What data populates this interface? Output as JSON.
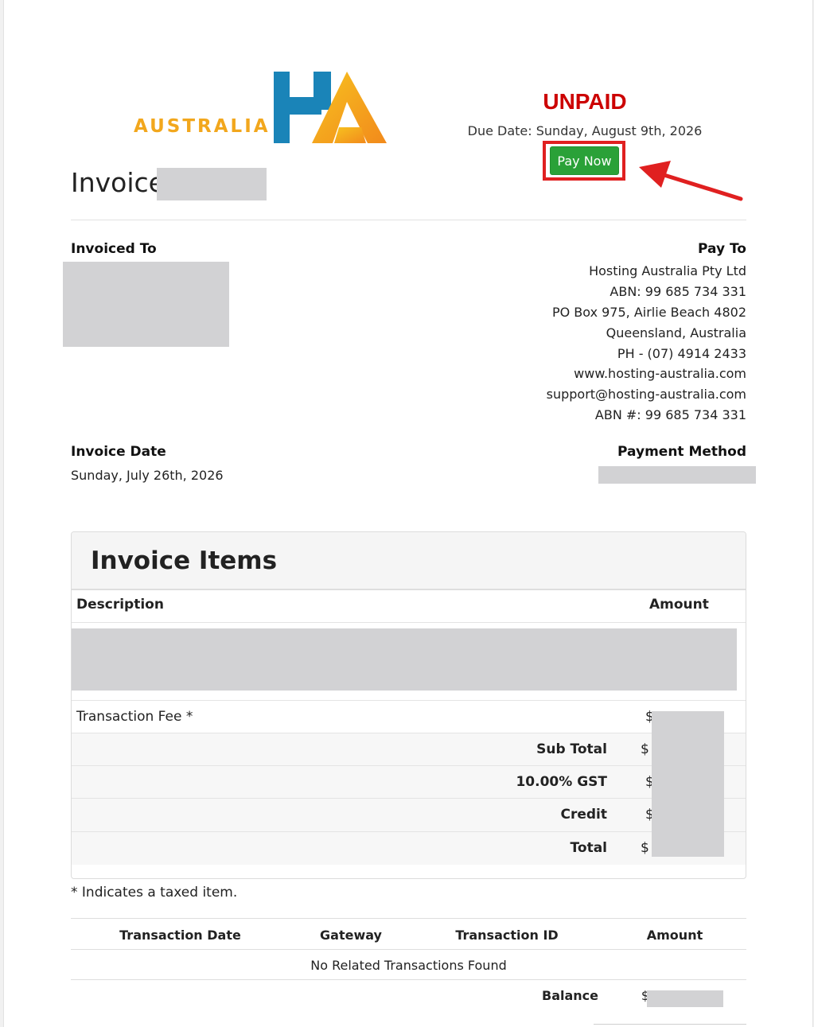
{
  "header": {
    "logo_text": "AUSTRALIA",
    "status": "UNPAID",
    "due_date": "Due Date: Sunday, August 9th, 2026",
    "pay_now_label": "Pay Now",
    "invoice_title": "Invoice"
  },
  "invoiced_to": {
    "label": "Invoiced To"
  },
  "pay_to": {
    "label": "Pay To",
    "lines": [
      "Hosting Australia Pty Ltd",
      "ABN: 99 685 734 331",
      "PO Box 975, Airlie Beach 4802",
      "Queensland, Australia",
      "PH - (07) 4914 2433",
      "www.hosting-australia.com",
      "support@hosting-australia.com",
      "ABN #: 99 685 734 331"
    ]
  },
  "invoice_date": {
    "label": "Invoice Date",
    "value": "Sunday, July 26th, 2026"
  },
  "payment_method": {
    "label": "Payment Method"
  },
  "items": {
    "title": "Invoice Items",
    "col_description": "Description",
    "col_amount": "Amount",
    "transaction_fee_label": "Transaction Fee *",
    "currency_symbol": "$",
    "subtotal_label": "Sub Total",
    "gst_label": "10.00% GST",
    "credit_label": "Credit",
    "total_label": "Total"
  },
  "taxed_note": "* Indicates a taxed item.",
  "transactions": {
    "headers": [
      "Transaction Date",
      "Gateway",
      "Transaction ID",
      "Amount"
    ],
    "empty_message": "No Related Transactions Found",
    "balance_label": "Balance",
    "currency_symbol": "$"
  },
  "colors": {
    "status_unpaid": "#cc0000",
    "pay_button": "#2aa138",
    "annotation_red": "#e02020",
    "logo_blue": "#1a84b8",
    "logo_orange": "#f5a11c"
  }
}
